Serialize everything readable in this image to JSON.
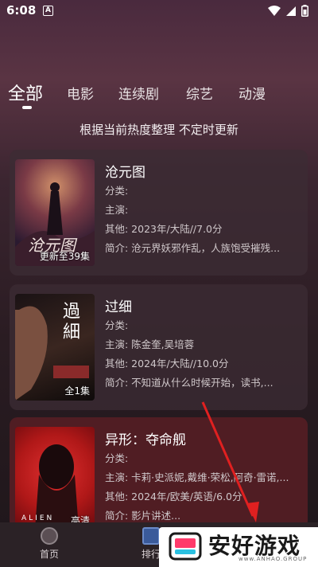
{
  "status_bar": {
    "time": "6:08",
    "notif": "A"
  },
  "tabs": [
    {
      "label": "全部",
      "active": true
    },
    {
      "label": "电影"
    },
    {
      "label": "连续剧"
    },
    {
      "label": "综艺"
    },
    {
      "label": "动漫"
    }
  ],
  "subtitle": "根据当前热度整理 不定时更新",
  "cards": [
    {
      "title": "沧元图",
      "badge": "更新至39集",
      "poster_text": "沧元图",
      "category": "分类:",
      "cast": "主演:",
      "other": "其他: 2023年/大陆//7.0分",
      "desc": "简介: 沧元界妖邪作乱，人族饱受摧残..."
    },
    {
      "title": "过细",
      "badge": "全1集",
      "poster_text": "過細",
      "category": "分类:",
      "cast": "主演: 陈金奎,吴培蓉",
      "other": "其他: 2024年/大陆//10.0分",
      "desc": "简介: 不知道从什么时候开始，读书,..."
    },
    {
      "title": "异形：夺命舰",
      "badge": "高清",
      "poster_text": "ALIEN",
      "category": "分类:",
      "cast": "主演: 卡莉·史派妮,戴维·荣松,阿奇·雷诺,...",
      "other": "其他: 2024年/欧美/英语/6.0分",
      "desc": "简介: 影片讲述..."
    }
  ],
  "bottom_nav": [
    {
      "label": "首页"
    },
    {
      "label": "排行"
    }
  ],
  "watermark": {
    "text": "安好游戏",
    "sub": "www.ANHAO.GROUP"
  },
  "colors": {
    "accent": "#ffffff",
    "card_red": "#581e24",
    "arrow": "#e02020"
  }
}
